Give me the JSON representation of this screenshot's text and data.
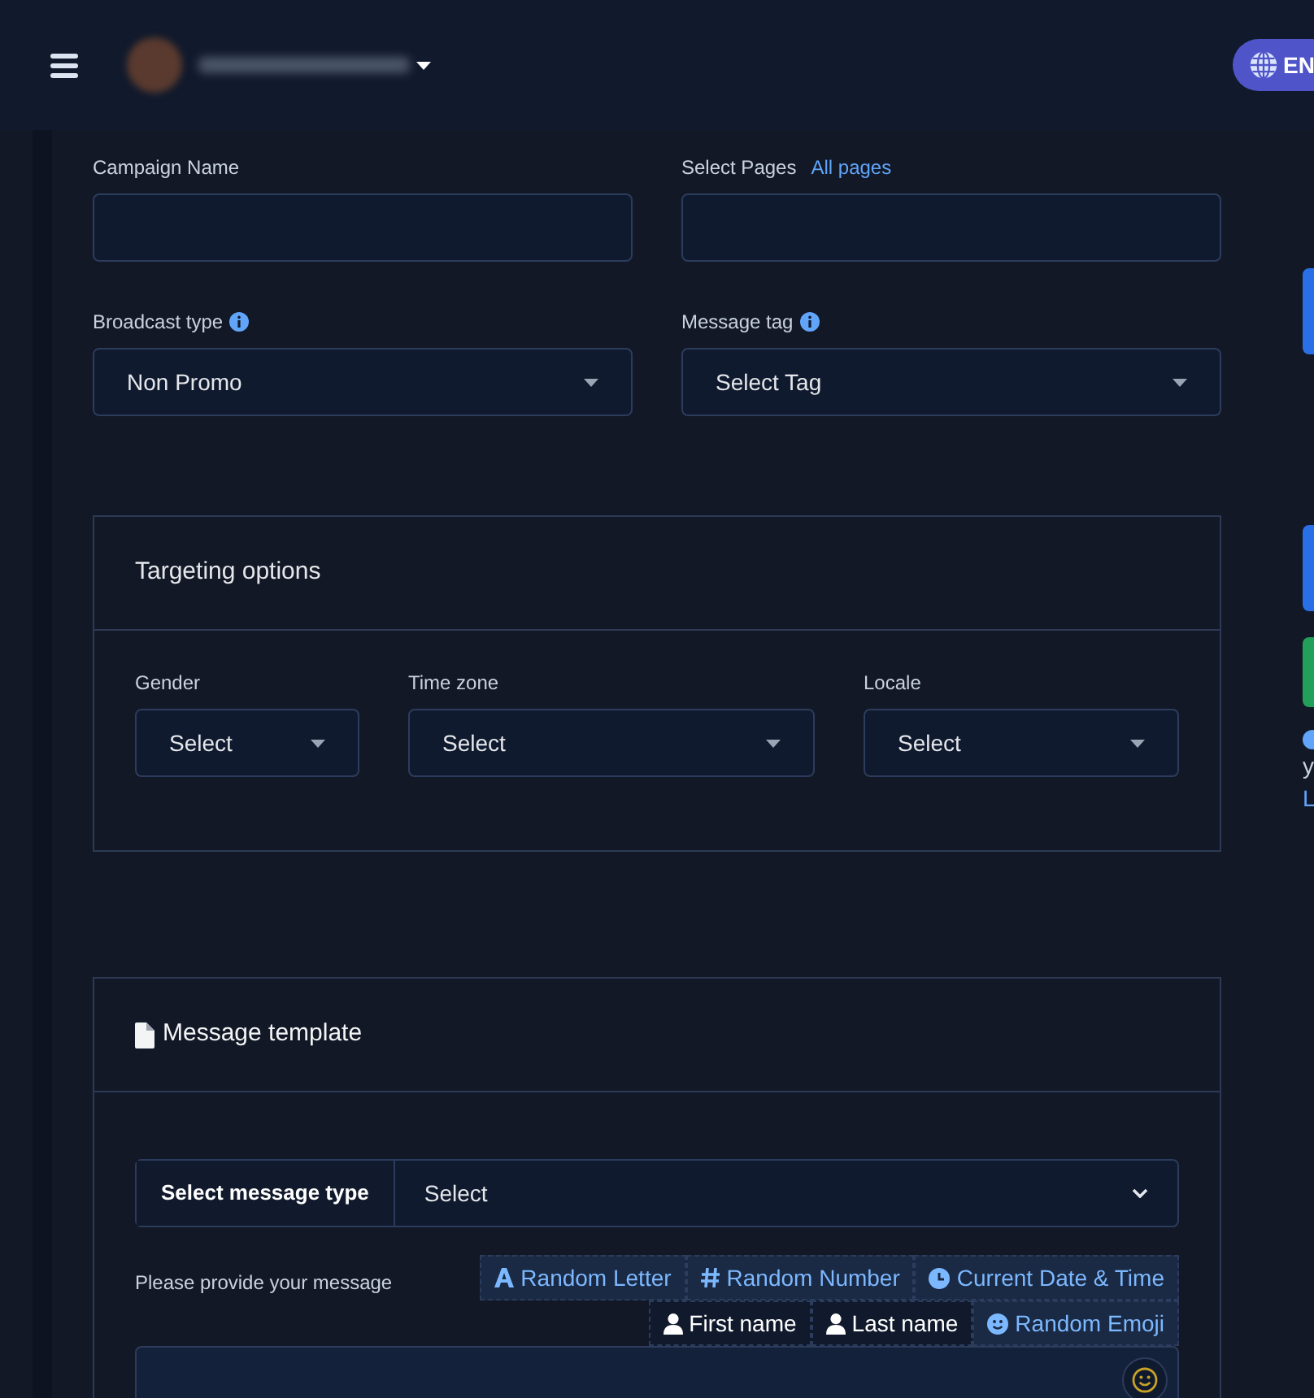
{
  "header": {
    "language": "EN"
  },
  "campaign_name": {
    "label": "Campaign Name"
  },
  "select_pages": {
    "label": "Select Pages",
    "link": "All pages"
  },
  "broadcast_type": {
    "label": "Broadcast type",
    "value": "Non Promo"
  },
  "message_tag": {
    "label": "Message tag",
    "value": "Select Tag"
  },
  "targeting": {
    "title": "Targeting options",
    "fields": [
      {
        "label": "Gender",
        "value": "Select"
      },
      {
        "label": "Time zone",
        "value": "Select"
      },
      {
        "label": "Locale",
        "value": "Select"
      }
    ]
  },
  "message_template": {
    "title": "Message template",
    "type_label": "Select message type",
    "type_value": "Select",
    "message_label": "Please provide your message",
    "insert_buttons": [
      {
        "label": "Random Letter",
        "kind": "letter"
      },
      {
        "label": "Random Number",
        "kind": "number"
      },
      {
        "label": "Current Date & Time",
        "kind": "datetime"
      },
      {
        "label": "First name",
        "kind": "name"
      },
      {
        "label": "Last name",
        "kind": "name"
      },
      {
        "label": "Random Emoji",
        "kind": "emoji"
      }
    ]
  },
  "side_panel": {
    "texts": [
      "y",
      "L"
    ]
  }
}
